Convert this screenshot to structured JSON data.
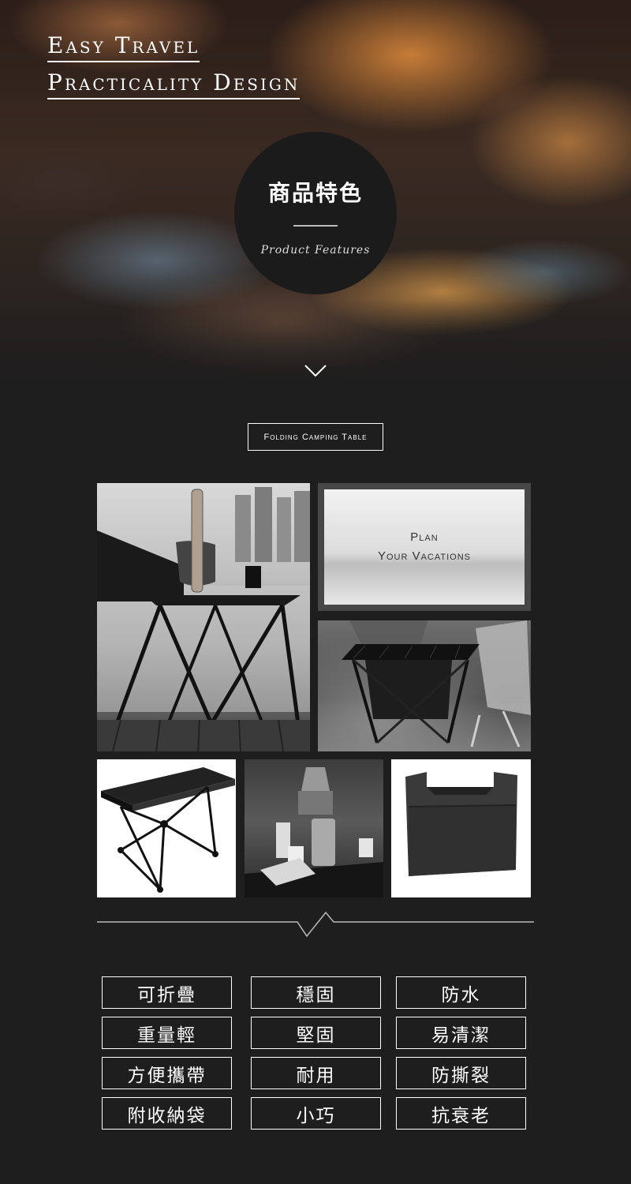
{
  "hero": {
    "line1": "Easy Travel",
    "line2": "Practicality Design",
    "circle_title": "商品特色",
    "circle_subtitle": "Product Features"
  },
  "section_label": "Folding Camping Table",
  "overlay": {
    "line1": "Plan",
    "line2": "Your Vacations"
  },
  "features": [
    [
      "可折疊",
      "穩固",
      "防水"
    ],
    [
      "重量輕",
      "堅固",
      "易清潔"
    ],
    [
      "方便攜帶",
      "耐用",
      "防撕裂"
    ],
    [
      "附收納袋",
      "小巧",
      "抗衰老"
    ]
  ],
  "colors": {
    "background": "#1f1e1e",
    "circle": "#1c1b1b",
    "text": "#ffffff"
  }
}
